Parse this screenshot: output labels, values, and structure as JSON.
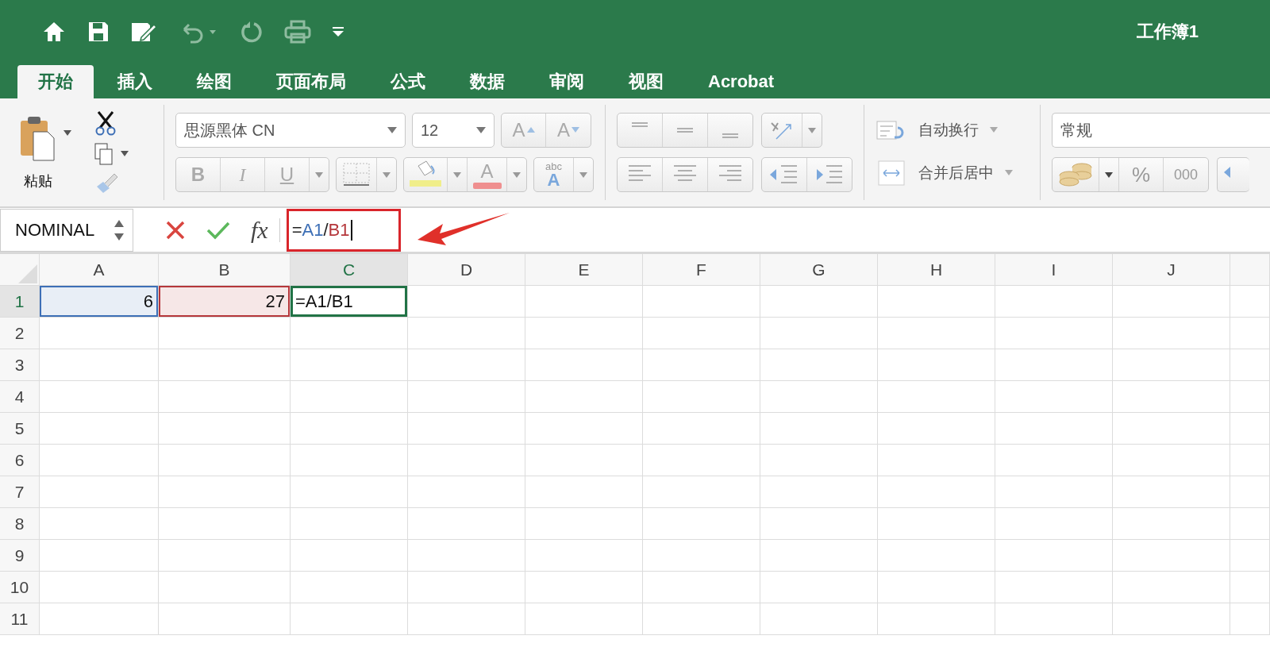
{
  "title_bar": {
    "title": "工作簿1"
  },
  "ribbon_tabs": [
    {
      "label": "开始",
      "selected": true
    },
    {
      "label": "插入",
      "selected": false
    },
    {
      "label": "绘图",
      "selected": false
    },
    {
      "label": "页面布局",
      "selected": false
    },
    {
      "label": "公式",
      "selected": false
    },
    {
      "label": "数据",
      "selected": false
    },
    {
      "label": "审阅",
      "selected": false
    },
    {
      "label": "视图",
      "selected": false
    },
    {
      "label": "Acrobat",
      "selected": false
    }
  ],
  "clipboard": {
    "paste_label": "粘贴"
  },
  "font": {
    "family": "思源黑体 CN",
    "size": "12",
    "grow_label": "A",
    "shrink_label": "A",
    "styles": [
      "B",
      "I",
      "U"
    ],
    "font_color_label": "A",
    "text_effects": [
      "abc",
      "A"
    ]
  },
  "alignment": {
    "wrap_text": "自动换行",
    "merge_center": "合并后居中"
  },
  "number": {
    "format": "常规",
    "percent": "%",
    "thousands": "000"
  },
  "formula_bar": {
    "name_box": "NOMINAL",
    "fx": "fx",
    "formula_parts": [
      {
        "text": "=",
        "color": "#222222"
      },
      {
        "text": "A1",
        "color": "#3d6fb6"
      },
      {
        "text": "/",
        "color": "#222222"
      },
      {
        "text": "B1",
        "color": "#b5373b"
      }
    ]
  },
  "sheet": {
    "columns": [
      {
        "label": "A",
        "selected": false
      },
      {
        "label": "B",
        "selected": false
      },
      {
        "label": "C",
        "selected": true
      },
      {
        "label": "D",
        "selected": false
      },
      {
        "label": "E",
        "selected": false
      },
      {
        "label": "F",
        "selected": false
      },
      {
        "label": "G",
        "selected": false
      },
      {
        "label": "H",
        "selected": false
      },
      {
        "label": "I",
        "selected": false
      },
      {
        "label": "J",
        "selected": false
      }
    ],
    "rows": [
      {
        "header": "1",
        "selected": true,
        "cells": [
          {
            "kind": "number",
            "value": "6",
            "color": "#3d6fb6",
            "selected": false
          },
          {
            "kind": "number",
            "value": "27",
            "color": "#b5373b",
            "selected": false
          },
          {
            "kind": "text",
            "value": "=A1/B1",
            "selected": true
          }
        ]
      },
      {
        "header": "2",
        "selected": false,
        "cells": []
      },
      {
        "header": "3",
        "selected": false,
        "cells": []
      },
      {
        "header": "4",
        "selected": false,
        "cells": []
      },
      {
        "header": "5",
        "selected": false,
        "cells": []
      },
      {
        "header": "6",
        "selected": false,
        "cells": []
      },
      {
        "header": "7",
        "selected": false,
        "cells": []
      },
      {
        "header": "8",
        "selected": false,
        "cells": []
      },
      {
        "header": "9",
        "selected": false,
        "cells": []
      },
      {
        "header": "10",
        "selected": false,
        "cells": []
      },
      {
        "header": "11",
        "selected": false,
        "cells": []
      }
    ]
  }
}
